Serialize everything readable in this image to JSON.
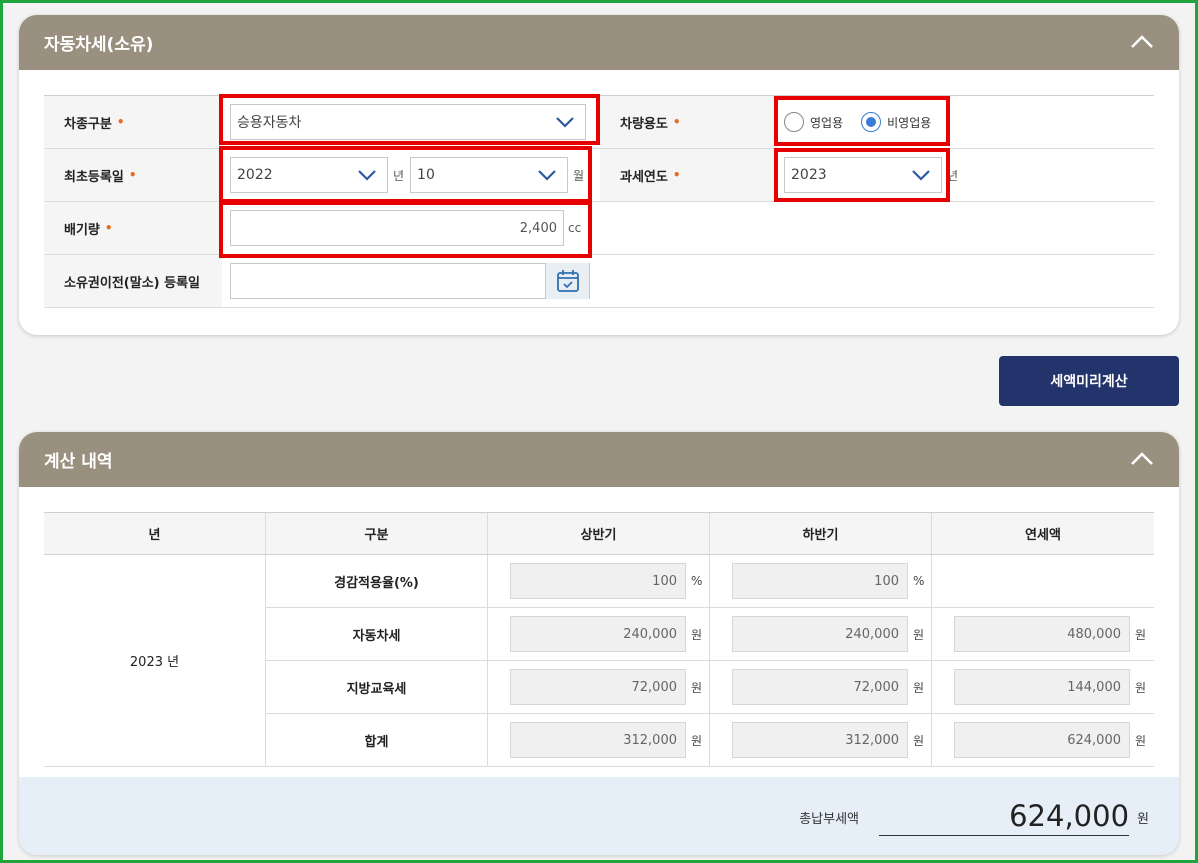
{
  "section1": {
    "title": "자동차세(소유)",
    "vehicle_type_label": "차종구분",
    "vehicle_type_value": "승용자동차",
    "usage_label": "차량용도",
    "usage_options": [
      "영업용",
      "비영업용"
    ],
    "usage_selected": "비영업용",
    "first_reg_label": "최초등록일",
    "first_reg_year": "2022",
    "first_reg_year_unit": "년",
    "first_reg_month": "10",
    "first_reg_month_unit": "월",
    "tax_year_label": "과세연도",
    "tax_year_value": "2023",
    "tax_year_unit": "년",
    "displacement_label": "배기량",
    "displacement_value": "2,400",
    "displacement_unit": "cc",
    "transfer_label": "소유권이전(말소) 등록일",
    "transfer_value": "",
    "required_mark": "•"
  },
  "calc_button": "세액미리계산",
  "section2": {
    "title": "계산 내역",
    "headers": [
      "년",
      "구분",
      "상반기",
      "하반기",
      "연세액"
    ],
    "year": "2023 년",
    "rows": [
      {
        "label": "경감적용율(%)",
        "first": "100",
        "first_unit": "%",
        "second": "100",
        "second_unit": "%",
        "annual": "",
        "annual_unit": ""
      },
      {
        "label": "자동차세",
        "first": "240,000",
        "first_unit": "원",
        "second": "240,000",
        "second_unit": "원",
        "annual": "480,000",
        "annual_unit": "원"
      },
      {
        "label": "지방교육세",
        "first": "72,000",
        "first_unit": "원",
        "second": "72,000",
        "second_unit": "원",
        "annual": "144,000",
        "annual_unit": "원"
      },
      {
        "label": "합계",
        "first": "312,000",
        "first_unit": "원",
        "second": "312,000",
        "second_unit": "원",
        "annual": "624,000",
        "annual_unit": "원"
      }
    ],
    "total_label": "총납부세액",
    "total_value": "624,000",
    "total_unit": "원"
  },
  "colors": {
    "header_bg": "#9a9080",
    "button_bg": "#22346b",
    "required": "#e86a1c",
    "highlight": "#e60000",
    "frame": "#1fa53c"
  }
}
